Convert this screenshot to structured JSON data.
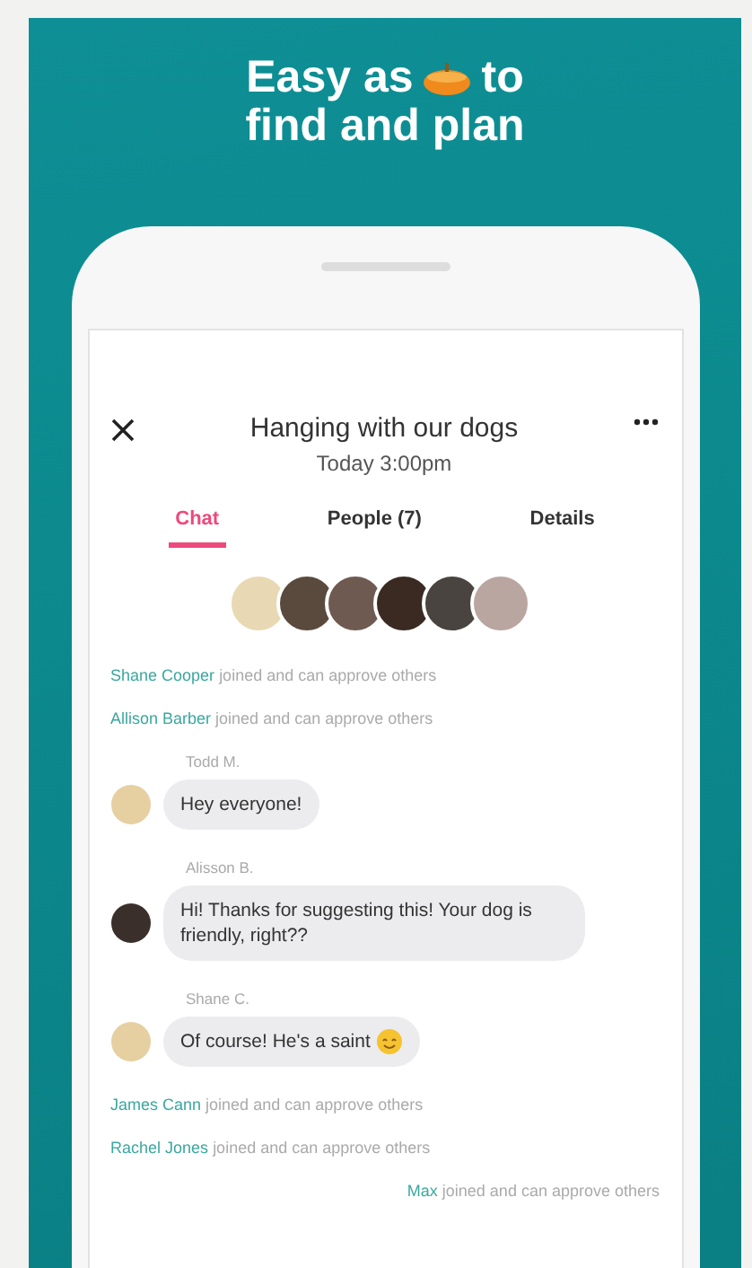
{
  "headline": {
    "before_icon": "Easy as",
    "after_icon": "to",
    "line_2": "find and plan"
  },
  "header": {
    "title": "Hanging with our dogs",
    "subtitle": "Today 3:00pm"
  },
  "tabs": [
    {
      "label": "Chat",
      "selected": true
    },
    {
      "label": "People (7)",
      "selected": false
    },
    {
      "label": "Details",
      "selected": false
    }
  ],
  "chat": [
    {
      "kind": "system",
      "name": "Shane Cooper",
      "text": "joined and can approve others"
    },
    {
      "kind": "system",
      "name": "Allison Barber",
      "text": "joined and can approve others"
    },
    {
      "kind": "message",
      "name": "Todd M.",
      "text": "Hey everyone!",
      "emoji": false
    },
    {
      "kind": "message",
      "name": "Alisson B.",
      "text": "Hi! Thanks for suggesting this! Your dog is friendly, right??",
      "emoji": false
    },
    {
      "kind": "message",
      "name": "Shane C.",
      "text": "Of course! He's a saint",
      "emoji": true
    },
    {
      "kind": "system",
      "name": "James Cann",
      "text": "joined and can approve others"
    },
    {
      "kind": "system",
      "name": "Rachel Jones",
      "text": "joined and can approve others"
    },
    {
      "kind": "system_right",
      "name": "Max",
      "text": "joined and can approve others"
    }
  ]
}
